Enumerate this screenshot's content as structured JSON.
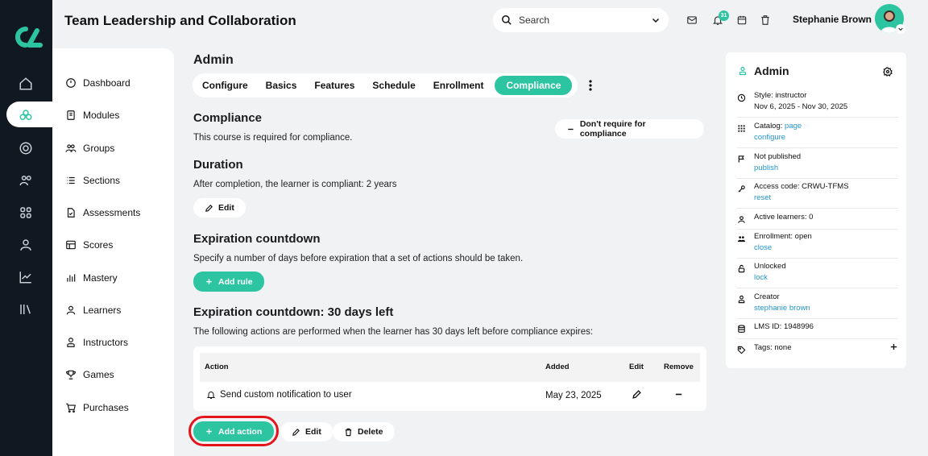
{
  "header": {
    "title": "Team Leadership and Collaboration",
    "search_placeholder": "Search",
    "notification_count": "31",
    "user_name": "Stephanie Brown"
  },
  "sidebar": {
    "items": [
      {
        "label": "Dashboard",
        "icon": "dashboard-icon"
      },
      {
        "label": "Modules",
        "icon": "modules-icon"
      },
      {
        "label": "Groups",
        "icon": "groups-icon"
      },
      {
        "label": "Sections",
        "icon": "sections-icon"
      },
      {
        "label": "Assessments",
        "icon": "assessments-icon"
      },
      {
        "label": "Scores",
        "icon": "scores-icon"
      },
      {
        "label": "Mastery",
        "icon": "mastery-icon"
      },
      {
        "label": "Learners",
        "icon": "learners-icon"
      },
      {
        "label": "Instructors",
        "icon": "instructors-icon"
      },
      {
        "label": "Games",
        "icon": "games-icon"
      },
      {
        "label": "Purchases",
        "icon": "purchases-icon"
      }
    ]
  },
  "main": {
    "title": "Admin",
    "tabs": [
      "Configure",
      "Basics",
      "Features",
      "Schedule",
      "Enrollment",
      "Compliance"
    ],
    "active_tab": "Compliance",
    "compliance": {
      "title": "Compliance",
      "text": "This course is required for compliance.",
      "toggle_label": "Don't require for compliance"
    },
    "duration": {
      "title": "Duration",
      "text": "After completion, the learner is compliant: 2 years",
      "edit_label": "Edit"
    },
    "expiration": {
      "title": "Expiration countdown",
      "text": "Specify a number of days before expiration that a set of actions should be taken.",
      "add_rule_label": "Add rule"
    },
    "rule": {
      "title": "Expiration countdown: 30 days left",
      "text": "The following actions are performed when the learner has 30 days left before compliance expires:",
      "columns": [
        "Action",
        "Added",
        "Edit",
        "Remove"
      ],
      "rows": [
        {
          "action": "Send custom notification to user",
          "added": "May 23, 2025"
        }
      ],
      "add_action_label": "Add action",
      "edit_label": "Edit",
      "delete_label": "Delete"
    }
  },
  "right_panel": {
    "title": "Admin",
    "style": "Style: instructor",
    "dates": "Nov 6, 2025 - Nov 30, 2025",
    "catalog_label": "Catalog:",
    "catalog_link": "page",
    "catalog_configure": "configure",
    "published": "Not published",
    "publish_link": "publish",
    "access_code": "Access code: CRWU-TFMS",
    "reset_link": "reset",
    "active_learners": "Active learners: 0",
    "enrollment": "Enrollment: open",
    "close_link": "close",
    "locked": "Unlocked",
    "lock_link": "lock",
    "creator_label": "Creator",
    "creator_link": "stephanie brown",
    "lms_id": "LMS ID: 1948996",
    "tags": "Tags: none"
  },
  "colors": {
    "accent": "#2dc5a1",
    "rail": "#101922",
    "link": "#2494c8",
    "highlight": "#e4141b"
  }
}
